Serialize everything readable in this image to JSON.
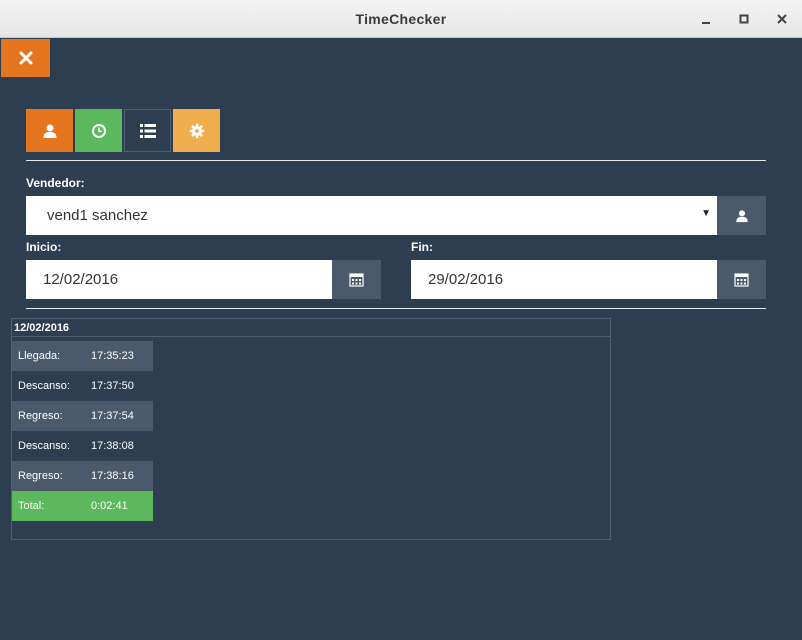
{
  "window": {
    "title": "TimeChecker"
  },
  "form": {
    "vendedor_label": "Vendedor:",
    "vendedor_value": "vend1 sanchez",
    "inicio_label": "Inicio:",
    "inicio_value": "12/02/2016",
    "fin_label": "Fin:",
    "fin_value": "29/02/2016"
  },
  "colors": {
    "background": "#2c3e50",
    "orange": "#e6751f",
    "green": "#5cb85c",
    "amber": "#f0ad4e",
    "slate": "#4a5a6a"
  },
  "toolbar": {
    "icons": [
      "user-icon",
      "clock-icon",
      "list-icon",
      "gear-icon"
    ]
  },
  "report": {
    "date": "12/02/2016",
    "rows": [
      {
        "label": "Llegada:",
        "time": "17:35:23"
      },
      {
        "label": "Descanso:",
        "time": "17:37:50"
      },
      {
        "label": "Regreso:",
        "time": "17:37:54"
      },
      {
        "label": "Descanso:",
        "time": "17:38:08"
      },
      {
        "label": "Regreso:",
        "time": "17:38:16"
      },
      {
        "label": "Total:",
        "time": "0:02:41"
      }
    ]
  }
}
